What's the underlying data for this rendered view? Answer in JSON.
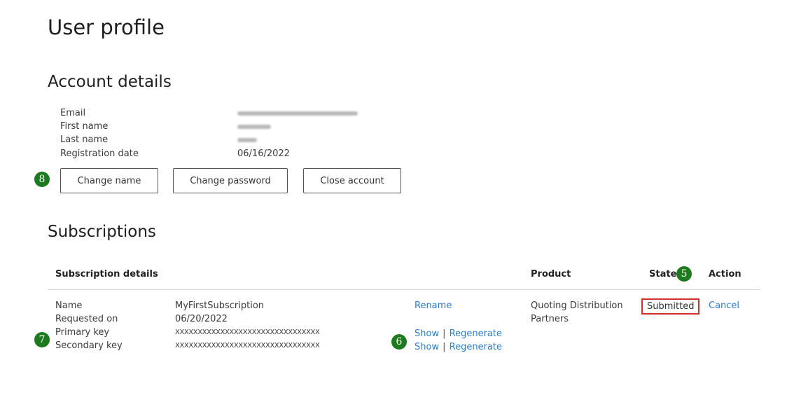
{
  "page": {
    "title": "User profile"
  },
  "account": {
    "heading": "Account details",
    "fields": [
      {
        "label": "Email",
        "value": ""
      },
      {
        "label": "First name",
        "value": ""
      },
      {
        "label": "Last name",
        "value": ""
      },
      {
        "label": "Registration date",
        "value": "06/16/2022"
      }
    ],
    "buttons": {
      "change_name": "Change name",
      "change_password": "Change password",
      "close_account": "Close account"
    }
  },
  "subscriptions": {
    "heading": "Subscriptions",
    "columns": {
      "details": "Subscription details",
      "product": "Product",
      "state": "State",
      "action": "Action"
    },
    "rows": [
      {
        "labels": [
          "Name",
          "Requested on",
          "Primary key",
          "Secondary key"
        ],
        "name": "MyFirstSubscription",
        "requested_on": "06/20/2022",
        "primary_key": "XXXXXXXXXXXXXXXXXXXXXXXXXXXXXXXX",
        "secondary_key": "XXXXXXXXXXXXXXXXXXXXXXXXXXXXXXXX",
        "rename": "Rename",
        "show": "Show",
        "separator": "|",
        "regenerate": "Regenerate",
        "product_line1": "Quoting Distribution",
        "product_line2": "Partners",
        "state": "Submitted",
        "cancel": "Cancel"
      }
    ]
  },
  "annotations": {
    "badge_5": "5",
    "badge_6": "6",
    "badge_7": "7",
    "badge_8": "8",
    "badge_color": "#1e7a1e",
    "highlight_color": "#d0312d"
  }
}
